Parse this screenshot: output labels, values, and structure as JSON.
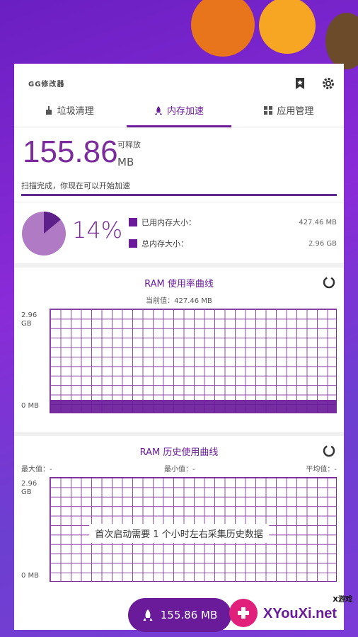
{
  "app": {
    "title": "GG修改器"
  },
  "tabs": [
    {
      "label": "垃圾清理",
      "icon": "broom-icon"
    },
    {
      "label": "内存加速",
      "icon": "rocket-icon"
    },
    {
      "label": "应用管理",
      "icon": "apps-grid-icon"
    }
  ],
  "release": {
    "value": "155.86",
    "label": "可释放",
    "unit": "MB",
    "scan_text": "扫描完成，你现在可以开始加速"
  },
  "memory": {
    "percent_label": "14%",
    "percent_value": 14,
    "used_label": "已用内存大小：",
    "used_value": "427.46 MB",
    "total_label": "总内存大小：",
    "total_value": "2.96 GB"
  },
  "ram_chart": {
    "title": "RAM 使用率曲线",
    "current": "当前值：427.46 MB",
    "y_top": "2.96",
    "y_top_unit": "GB",
    "y_bottom": "0 MB"
  },
  "history_chart": {
    "title": "RAM 历史使用曲线",
    "max_label": "最大值：-",
    "min_label": "最小值：-",
    "avg_label": "平均值：-",
    "y_top": "2.96",
    "y_top_unit": "GB",
    "y_bottom": "0 MB",
    "message": "首次启动需要 1 个小时左右采集历史数据"
  },
  "fab": {
    "label": "155.86 MB",
    "icon": "rocket-icon"
  },
  "watermark": {
    "text": "XYouXi.net",
    "small": "X游戏"
  },
  "colors": {
    "accent": "#6a1b9a",
    "background": "#7b2bd0"
  }
}
